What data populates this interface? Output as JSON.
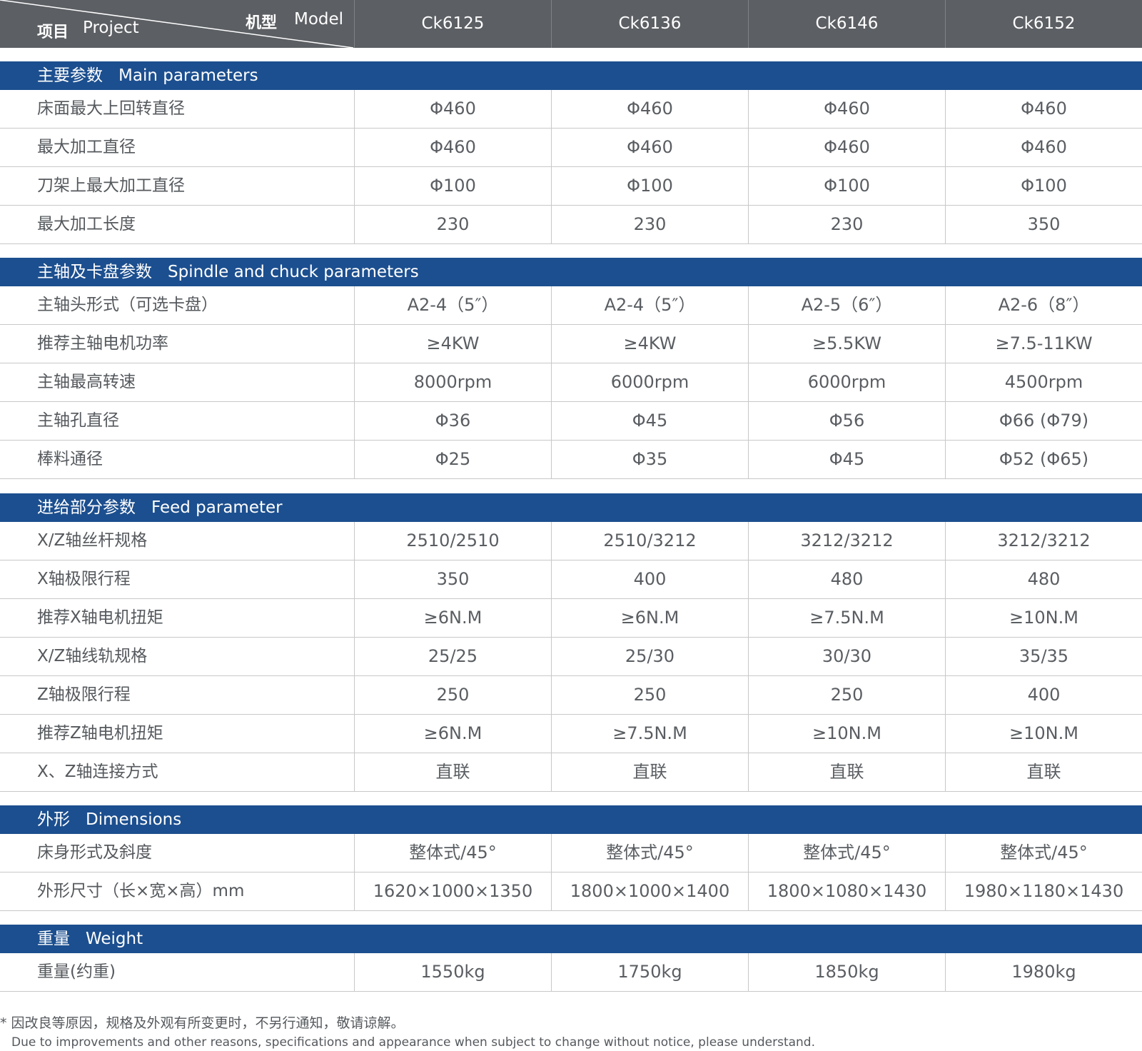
{
  "header": {
    "model_cn": "机型",
    "model_en": "Model",
    "project_cn": "项目",
    "project_en": "Project",
    "models": [
      "Ck6125",
      "Ck6136",
      "Ck6146",
      "Ck6152"
    ]
  },
  "sections": [
    {
      "title_cn": "主要参数",
      "title_en": "Main parameters",
      "rows": [
        {
          "label": "床面最大上回转直径",
          "values": [
            "Φ460",
            "Φ460",
            "Φ460",
            "Φ460"
          ]
        },
        {
          "label": "最大加工直径",
          "values": [
            "Φ460",
            "Φ460",
            "Φ460",
            "Φ460"
          ]
        },
        {
          "label": "刀架上最大加工直径",
          "values": [
            "Φ100",
            "Φ100",
            "Φ100",
            "Φ100"
          ]
        },
        {
          "label": "最大加工长度",
          "values": [
            "230",
            "230",
            "230",
            "350"
          ]
        }
      ]
    },
    {
      "title_cn": "主轴及卡盘参数",
      "title_en": "Spindle and chuck parameters",
      "rows": [
        {
          "label": "主轴头形式（可选卡盘）",
          "values": [
            "A2-4（5″）",
            "A2-4（5″）",
            "A2-5（6″）",
            "A2-6（8″）"
          ]
        },
        {
          "label": "推荐主轴电机功率",
          "values": [
            "≥4KW",
            "≥4KW",
            "≥5.5KW",
            "≥7.5-11KW"
          ]
        },
        {
          "label": "主轴最高转速",
          "values": [
            "8000rpm",
            "6000rpm",
            "6000rpm",
            "4500rpm"
          ]
        },
        {
          "label": "主轴孔直径",
          "values": [
            "Φ36",
            "Φ45",
            "Φ56",
            "Φ66 (Φ79)"
          ]
        },
        {
          "label": "棒料通径",
          "values": [
            "Φ25",
            "Φ35",
            "Φ45",
            "Φ52 (Φ65)"
          ]
        }
      ]
    },
    {
      "title_cn": "进给部分参数",
      "title_en": "Feed parameter",
      "rows": [
        {
          "label": "X/Z轴丝杆规格",
          "values": [
            "2510/2510",
            "2510/3212",
            "3212/3212",
            "3212/3212"
          ]
        },
        {
          "label": "X轴极限行程",
          "values": [
            "350",
            "400",
            "480",
            "480"
          ]
        },
        {
          "label": "推荐X轴电机扭矩",
          "values": [
            "≥6N.M",
            "≥6N.M",
            "≥7.5N.M",
            "≥10N.M"
          ]
        },
        {
          "label": "X/Z轴线轨规格",
          "values": [
            "25/25",
            "25/30",
            "30/30",
            "35/35"
          ]
        },
        {
          "label": "Z轴极限行程",
          "values": [
            "250",
            "250",
            "250",
            "400"
          ]
        },
        {
          "label": "推荐Z轴电机扭矩",
          "values": [
            "≥6N.M",
            "≥7.5N.M",
            "≥10N.M",
            "≥10N.M"
          ]
        },
        {
          "label": "X、Z轴连接方式",
          "values": [
            "直联",
            "直联",
            "直联",
            "直联"
          ]
        }
      ]
    },
    {
      "title_cn": "外形",
      "title_en": "Dimensions",
      "rows": [
        {
          "label": "床身形式及斜度",
          "values": [
            "整体式/45°",
            "整体式/45°",
            "整体式/45°",
            "整体式/45°"
          ]
        },
        {
          "label": "外形尺寸（长×宽×高）mm",
          "values": [
            "1620×1000×1350",
            "1800×1000×1400",
            "1800×1080×1430",
            "1980×1180×1430"
          ]
        }
      ]
    },
    {
      "title_cn": "重量",
      "title_en": "Weight",
      "rows": [
        {
          "label": "重量(约重)",
          "values": [
            "1550kg",
            "1750kg",
            "1850kg",
            "1980kg"
          ]
        }
      ]
    }
  ],
  "footnote": {
    "cn": "* 因改良等原因，规格及外观有所变更时，不另行通知，敬请谅解。",
    "en": "Due to improvements and other reasons, specifications and appearance when subject to change without notice, please understand."
  },
  "colors": {
    "header_bg": "#5c5f63",
    "section_bg": "#1c4f8f",
    "row_divider": "#c8c8c8",
    "text": "#55595d"
  }
}
